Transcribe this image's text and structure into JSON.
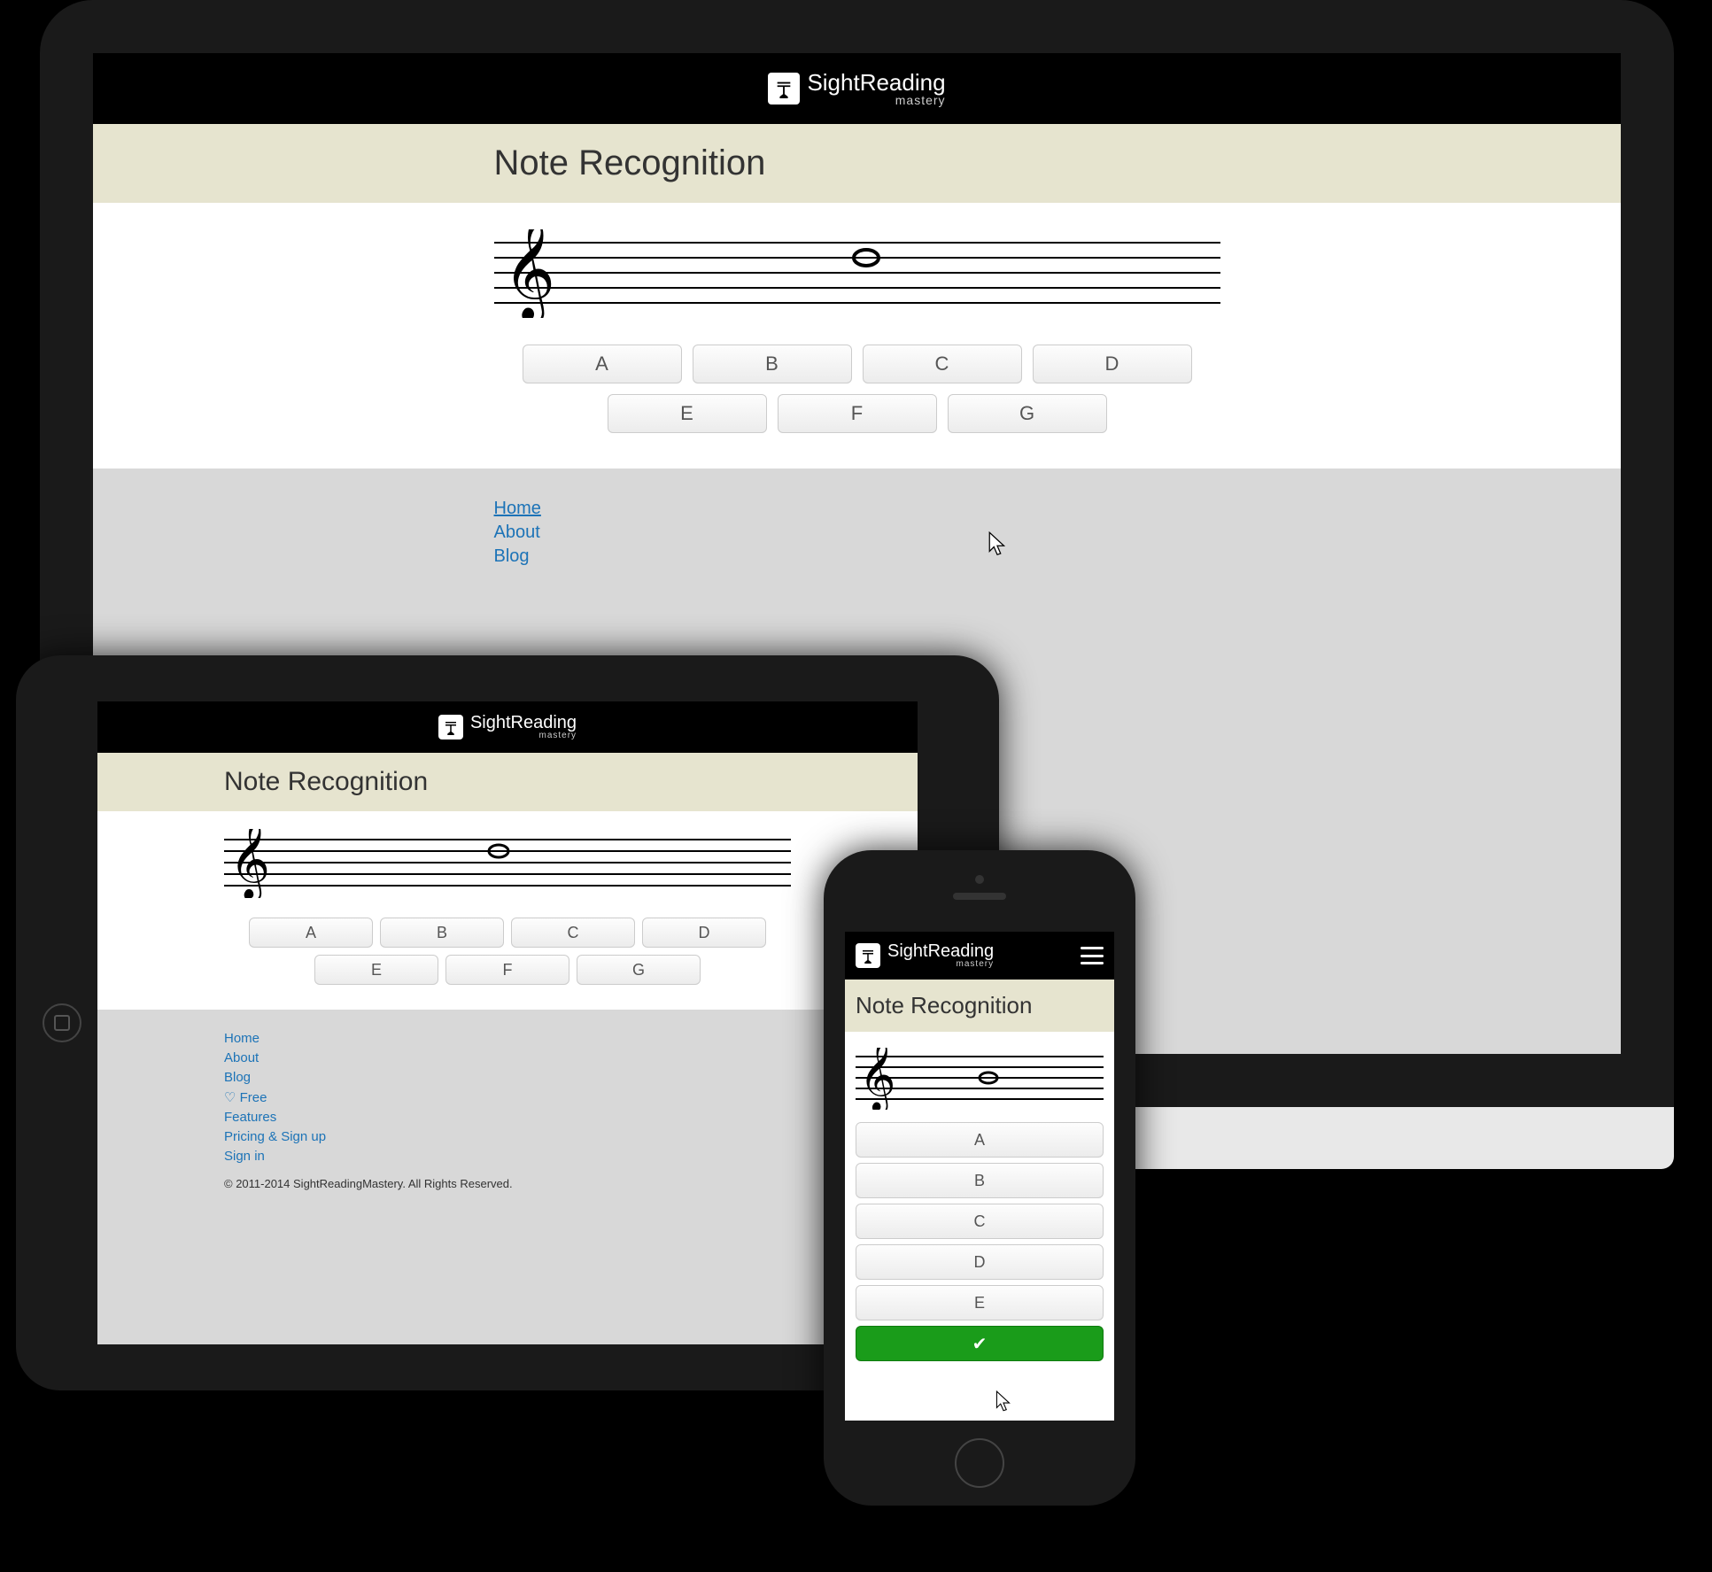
{
  "app": {
    "logo_main": "SightReading",
    "logo_sub": "mastery"
  },
  "page": {
    "title": "Note Recognition"
  },
  "answers": {
    "row1": [
      "A",
      "B",
      "C",
      "D"
    ],
    "row2": [
      "E",
      "F",
      "G"
    ]
  },
  "iphone_answers": [
    "A",
    "B",
    "C",
    "D",
    "E"
  ],
  "footer": {
    "links_imac": [
      "Home",
      "About",
      "Blog"
    ],
    "links_ipad": [
      "Home",
      "About",
      "Blog",
      "♡ Free",
      "Features",
      "Pricing & Sign up",
      "Sign in"
    ],
    "active_link": "Home",
    "copyright": "© 2011-2014 SightReadingMastery. All Rights Reserved."
  }
}
